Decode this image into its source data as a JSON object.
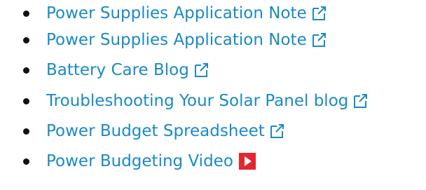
{
  "links": [
    {
      "label": "Power Supplies Application Note",
      "icon": "external-link-icon"
    },
    {
      "label": "Power Supplies Application Note",
      "icon": "external-link-icon"
    },
    {
      "label": "Battery Care Blog",
      "icon": "external-link-icon"
    },
    {
      "label": "Troubleshooting Your Solar Panel blog",
      "icon": "external-link-icon"
    },
    {
      "label": "Power Budget Spreadsheet",
      "icon": "external-link-icon"
    },
    {
      "label": "Power Budgeting Video",
      "icon": "video-play-icon"
    }
  ],
  "colors": {
    "link": "#1a8ac4",
    "bullet": "#111111",
    "play_icon_bg": "#e5262e"
  }
}
